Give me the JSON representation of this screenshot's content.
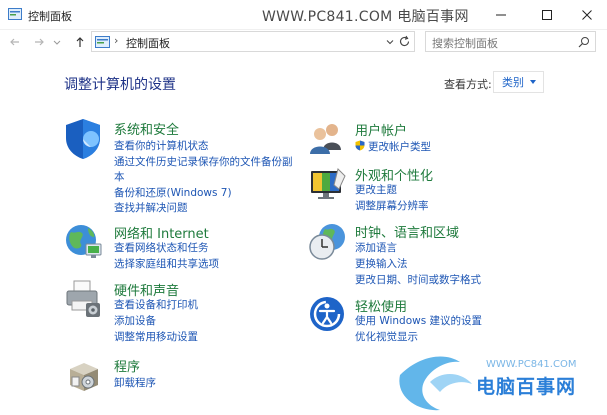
{
  "window": {
    "title": "控制面板",
    "watermark": "WWW.PC841.COM 电脑百事网"
  },
  "address": {
    "path": "控制面板",
    "separator": "›",
    "search_placeholder": "搜索控制面板"
  },
  "content": {
    "heading": "调整计算机的设置",
    "view_by_label": "查看方式:",
    "view_by_value": "类别"
  },
  "categories": [
    {
      "title": "系统和安全",
      "links": [
        "查看你的计算机状态",
        "通过文件历史记录保存你的文件备份副",
        "本",
        "备份和还原(Windows 7)",
        "查找并解决问题"
      ]
    },
    {
      "title": "网络和 Internet",
      "links": [
        "查看网络状态和任务",
        "选择家庭组和共享选项"
      ]
    },
    {
      "title": "硬件和声音",
      "links": [
        "查看设备和打印机",
        "添加设备",
        "调整常用移动设置"
      ]
    },
    {
      "title": "程序",
      "links": [
        "卸载程序"
      ]
    },
    {
      "title": "用户帐户",
      "links": [
        "更改帐户类型"
      ]
    },
    {
      "title": "外观和个性化",
      "links": [
        "更改主题",
        "调整屏幕分辨率"
      ]
    },
    {
      "title": "时钟、语言和区域",
      "links": [
        "添加语言",
        "更换输入法",
        "更改日期、时间或数字格式"
      ]
    },
    {
      "title": "轻松使用",
      "links": [
        "使用 Windows 建议的设置",
        "优化视觉显示"
      ]
    }
  ],
  "bottom_watermark": {
    "small": "WWW.PC841.COM",
    "big": "电脑百事网"
  },
  "colors": {
    "heading": "#1e3287",
    "category_title": "#1e7a3c",
    "link": "#1e56b4"
  }
}
